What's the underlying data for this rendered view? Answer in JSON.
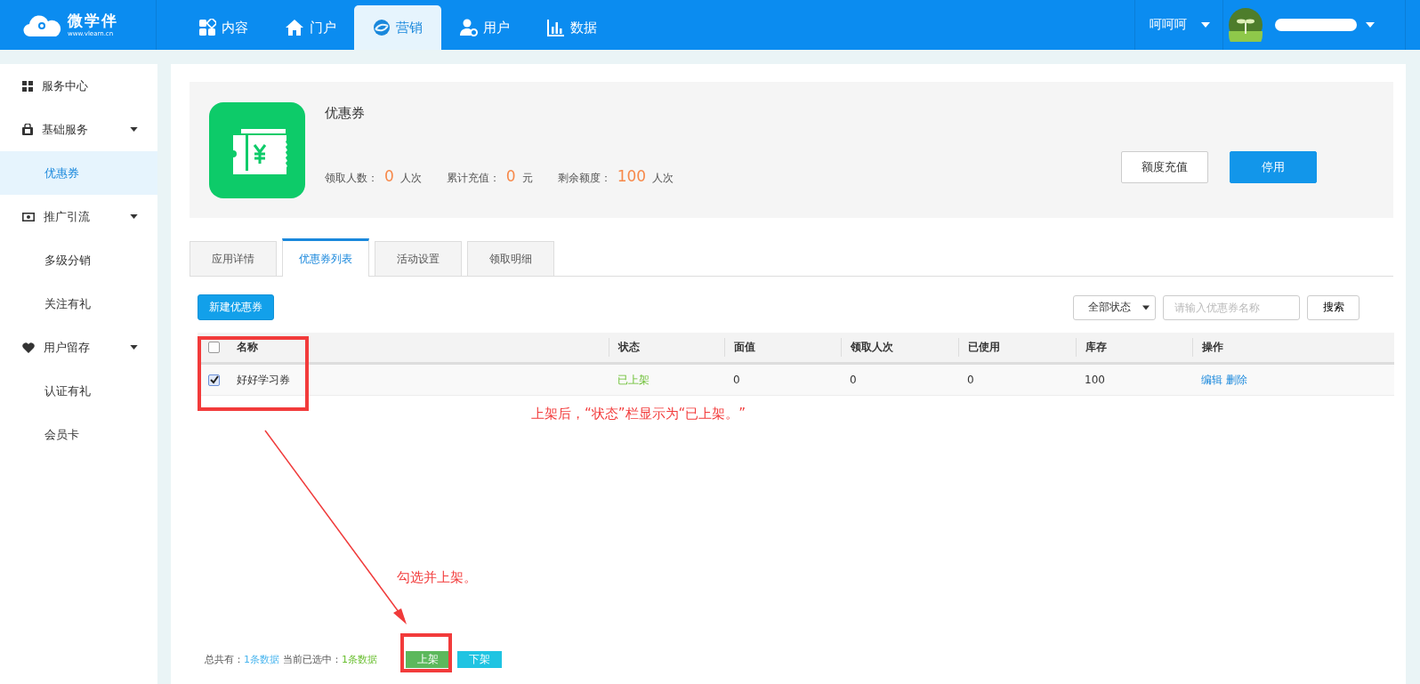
{
  "topbar": {
    "logo": {
      "name": "微学伴",
      "url": "www.vlearn.cn"
    },
    "nav": [
      {
        "label": "内容",
        "kind": "grid",
        "selected": false
      },
      {
        "label": "门户",
        "kind": "home",
        "selected": false
      },
      {
        "label": "营销",
        "kind": "swirl",
        "selected": true
      },
      {
        "label": "用户",
        "kind": "user",
        "selected": false
      },
      {
        "label": "数据",
        "kind": "chart",
        "selected": false
      }
    ],
    "account": {
      "name": "呵呵呵"
    }
  },
  "sidebar": {
    "items": [
      {
        "label": "服务中心",
        "kind": "grid",
        "selected": false
      },
      {
        "label": "基础服务",
        "kind": "bag",
        "expanded": true,
        "selected": false,
        "children": [
          {
            "label": "优惠券",
            "selected": true
          }
        ]
      },
      {
        "label": "推广引流",
        "kind": "money",
        "expanded": true,
        "selected": false,
        "children": [
          {
            "label": "多级分销",
            "selected": false
          },
          {
            "label": "关注有礼",
            "selected": false
          }
        ]
      },
      {
        "label": "用户留存",
        "kind": "heart",
        "expanded": true,
        "selected": false,
        "children": [
          {
            "label": "认证有礼",
            "selected": false
          },
          {
            "label": "会员卡",
            "selected": false
          }
        ]
      }
    ]
  },
  "app_card": {
    "title": "优惠券",
    "stats": [
      {
        "label": "领取人数：",
        "value": "0",
        "unit": "人次"
      },
      {
        "label": "累计充值：",
        "value": "0",
        "unit": "元"
      },
      {
        "label": "剩余额度：",
        "value": "100",
        "unit": "人次"
      }
    ],
    "buttons": [
      {
        "label": "额度充值",
        "kind": "secondary"
      },
      {
        "label": "停用",
        "kind": "primary"
      }
    ]
  },
  "tabs": [
    {
      "label": "应用详情",
      "selected": false
    },
    {
      "label": "优惠券列表",
      "selected": true
    },
    {
      "label": "活动设置",
      "selected": false
    },
    {
      "label": "领取明细",
      "selected": false
    }
  ],
  "toolbar": {
    "new_button": "新建优惠券",
    "status_filter": "全部状态",
    "search": {
      "placeholder": "请输入优惠券名称"
    },
    "search_button": "搜索"
  },
  "table": {
    "all_checked": false,
    "columns": [
      "名称",
      "状态",
      "面值",
      "领取人次",
      "已使用",
      "库存",
      "操作"
    ],
    "rows": [
      {
        "checked": true,
        "name": "好好学习券",
        "status": "已上架",
        "face_value": "0",
        "claimed": "0",
        "used": "0",
        "stock": "100",
        "actions": [
          "编辑",
          "删除"
        ]
      }
    ]
  },
  "footer": {
    "total_label": "总共有：",
    "total": "1条数据",
    "selected_label": "当前已选中：",
    "selected": "1条数据",
    "buttons": [
      {
        "label": "上架",
        "kind": "publish"
      },
      {
        "label": "下架",
        "kind": "unpublish"
      }
    ]
  },
  "annotations": [
    {
      "text": "上架后，“状态”栏显示为“已上架。”"
    },
    {
      "text": "勾选并上架。"
    }
  ]
}
